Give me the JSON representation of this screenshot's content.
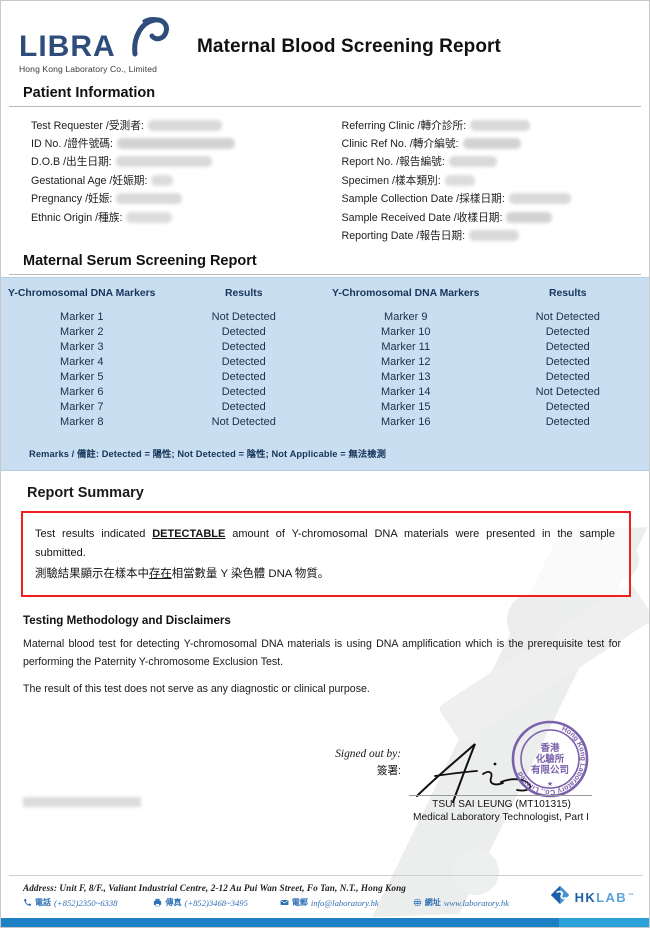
{
  "header": {
    "logo_word": "LIBRA",
    "logo_tagline": "Hong Kong Laboratory Co., Limited",
    "document_title": "Maternal Blood Screening Report",
    "brand_color": "#2e4d7b"
  },
  "patient_information": {
    "section_title": "Patient Information",
    "left_fields": [
      {
        "label": "Test Requester /受測者:",
        "value": "",
        "redacted": true
      },
      {
        "label": "ID No. /證件號碼:",
        "value": "",
        "redacted": true
      },
      {
        "label": "D.O.B /出生日期:",
        "value": "",
        "redacted": true
      },
      {
        "label": "Gestational Age /妊娠期:",
        "value": "",
        "redacted": true
      },
      {
        "label": "Pregnancy /妊娠:",
        "value": "",
        "redacted": true
      },
      {
        "label": "Ethnic Origin /種族:",
        "value": "",
        "redacted": true
      }
    ],
    "right_fields": [
      {
        "label": "Referring Clinic /轉介診所:",
        "value": "",
        "redacted": true
      },
      {
        "label": "Clinic Ref No. /轉介編號:",
        "value": "",
        "redacted": true
      },
      {
        "label": "Report No. /報告編號:",
        "value": "",
        "redacted": true
      },
      {
        "label": "Specimen /樣本類別:",
        "value": "",
        "redacted": true
      },
      {
        "label": "Sample Collection Date /採樣日期:",
        "value": "",
        "redacted": true
      },
      {
        "label": "Sample Received Date /收樣日期:",
        "value": "",
        "redacted": true
      },
      {
        "label": "Reporting Date /報告日期:",
        "value": "",
        "redacted": true
      }
    ]
  },
  "serum_report": {
    "section_title": "Maternal Serum Screening Report",
    "columns": [
      "Y-Chromosomal DNA Markers",
      "Results",
      "Y-Chromosomal DNA Markers",
      "Results"
    ],
    "rows": [
      {
        "marker_left": "Marker 1",
        "result_left": "Not Detected",
        "marker_right": "Marker 9",
        "result_right": "Not Detected"
      },
      {
        "marker_left": "Marker 2",
        "result_left": "Detected",
        "marker_right": "Marker 10",
        "result_right": "Detected"
      },
      {
        "marker_left": "Marker 3",
        "result_left": "Detected",
        "marker_right": "Marker 11",
        "result_right": "Detected"
      },
      {
        "marker_left": "Marker 4",
        "result_left": "Detected",
        "marker_right": "Marker 12",
        "result_right": "Detected"
      },
      {
        "marker_left": "Marker 5",
        "result_left": "Detected",
        "marker_right": "Marker 13",
        "result_right": "Detected"
      },
      {
        "marker_left": "Marker 6",
        "result_left": "Detected",
        "marker_right": "Marker 14",
        "result_right": "Not Detected"
      },
      {
        "marker_left": "Marker 7",
        "result_left": "Detected",
        "marker_right": "Marker 15",
        "result_right": "Detected"
      },
      {
        "marker_left": "Marker 8",
        "result_left": "Not Detected",
        "marker_right": "Marker 16",
        "result_right": "Detected"
      }
    ],
    "remarks": "Remarks /  備註: Detected =  陽性; Not Detected =  陰性; Not Applicable =  無法檢測",
    "table_bg_color": "#c9def0",
    "table_text_color": "#16355a"
  },
  "report_summary": {
    "section_title": "Report Summary",
    "english_before": "Test results indicated ",
    "english_emphasis": "DETECTABLE",
    "english_after": " amount of Y-chromosomal DNA materials were presented in the sample submitted.",
    "chinese_before": "測驗結果顯示在樣本中",
    "chinese_emphasis": "存在",
    "chinese_after": "相當數量 Y 染色體 DNA 物質。",
    "highlight_color": "#ef1f1f"
  },
  "methodology": {
    "section_title": "Testing Methodology and Disclaimers",
    "paragraphs": [
      "Maternal blood test for detecting Y-chromosomal DNA materials is using DNA amplification which is the prerequisite test for performing the Paternity Y-chromosome Exclusion Test.",
      "The result of this test does not serve as any diagnostic or clinical purpose."
    ]
  },
  "signature": {
    "signed_out_by": "Signed out by:",
    "signed_out_by_zh": "簽署:",
    "name": "TSUI SAI LEUNG (MT101315)",
    "title": "Medical Laboratory Technologist, Part I",
    "stamp_outer_text": "Hong Kong Laboratory Co., Limited",
    "stamp_inner_text": "香港化驗所有限公司",
    "stamp_color": "#7b61ab"
  },
  "footer": {
    "address": "Address: Unit F, 8/F., Valiant Industrial Centre, 2-12 Au Pui Wan Street, Fo Tan, N.T., Hong Kong",
    "contacts": [
      {
        "icon": "phone-icon",
        "zh": "電話",
        "value": "(+852)2350~6338"
      },
      {
        "icon": "fax-icon",
        "zh": "傳真",
        "value": "(+852)3468~3495"
      },
      {
        "icon": "email-icon",
        "zh": "電郵",
        "value": "info@laboratory.hk"
      },
      {
        "icon": "globe-icon",
        "zh": "網址",
        "value": "www.laboratory.hk"
      }
    ],
    "brand_hk": "HK",
    "brand_lab": "LAB",
    "brand_tm": "™",
    "bar_color": "#1d7fc4",
    "accent_color": "#2aa2d8"
  }
}
